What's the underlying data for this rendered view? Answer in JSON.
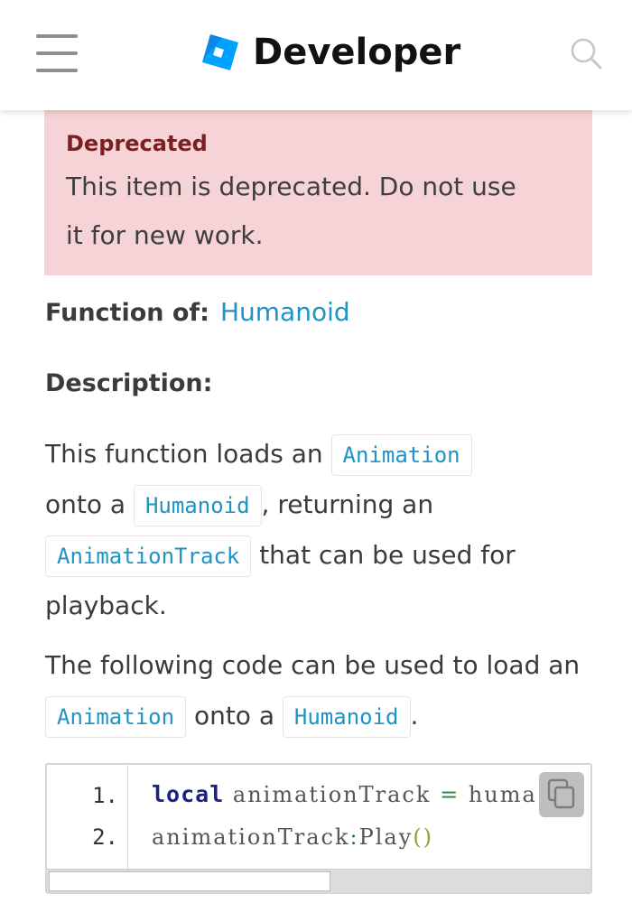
{
  "header": {
    "brand": "Developer",
    "menu_icon": "hamburger-menu-icon",
    "search_icon": "search-icon",
    "logo_icon": "roblox-logo-icon",
    "logo_color": "#00A2FF"
  },
  "notice": {
    "title": "Deprecated",
    "text_line1": "This item is deprecated. Do not use",
    "text_line2": "it for new work.",
    "background": "#F5D3D6",
    "title_color": "#7A1F22"
  },
  "function_of": {
    "label": "Function of:",
    "link": "Humanoid"
  },
  "description": {
    "label": "Description:"
  },
  "paragraph1": {
    "t1": "This function loads an",
    "code1": "Animation",
    "t2": "onto a",
    "code2": "Humanoid",
    "t3": ", returning an",
    "code3": "AnimationTrack",
    "t4": "that can be used for playback."
  },
  "paragraph2": {
    "t1": "The following code can be used to load an",
    "code1": "Animation",
    "t2": "onto a",
    "code2": "Humanoid",
    "t3": "."
  },
  "code_block": {
    "line_numbers": [
      "1.",
      "2."
    ],
    "line1": {
      "keyword": "local",
      "var": "animationTrack",
      "op": "=",
      "rest": "huma"
    },
    "line2": {
      "obj": "animationTrack",
      "sep": ":",
      "method": "Play",
      "parens": "()"
    },
    "copy_icon": "copy-icon"
  },
  "link_color": "#1E93C6"
}
